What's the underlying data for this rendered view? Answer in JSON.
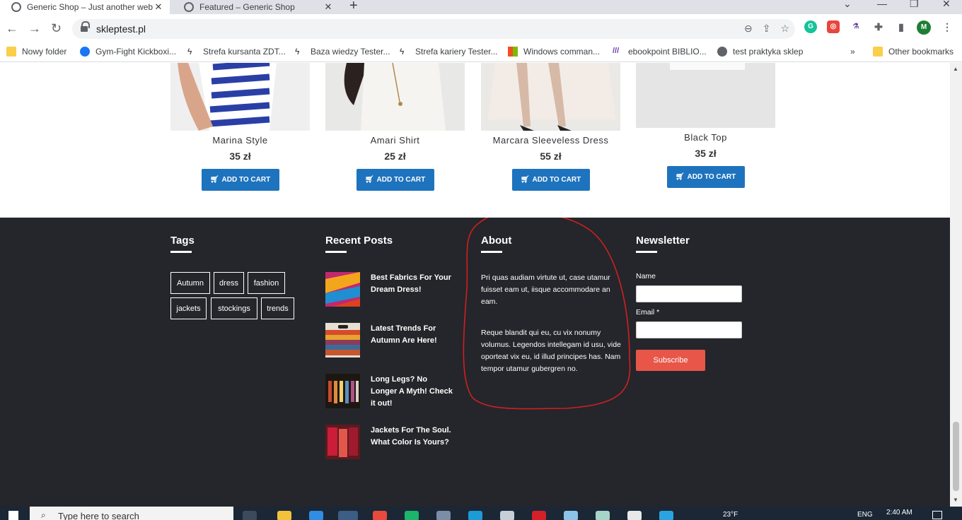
{
  "browser": {
    "tabs": [
      {
        "title": "Generic Shop – Just another web",
        "active": true
      },
      {
        "title": "Featured – Generic Shop",
        "active": false
      }
    ],
    "url": "skleptest.pl",
    "extension_avatar": "M",
    "bookmarks": [
      {
        "label": "Nowy folder",
        "icon": "folder-icon"
      },
      {
        "label": "Gym-Fight Kickboxi...",
        "icon": "facebook-icon"
      },
      {
        "label": "Strefa kursanta ZDT...",
        "icon": "zdt-icon"
      },
      {
        "label": "Baza wiedzy Tester...",
        "icon": "zdt-icon"
      },
      {
        "label": "Strefa kariery Tester...",
        "icon": "zdt-icon"
      },
      {
        "label": "Windows comman...",
        "icon": "windows-icon"
      },
      {
        "label": "ebookpoint BIBLIO...",
        "icon": "ebookpoint-icon"
      },
      {
        "label": "test praktyka sklep",
        "icon": "globe-icon"
      }
    ],
    "bookmarks_overflow": "»",
    "other_bookmarks": "Other bookmarks"
  },
  "products": [
    {
      "name": "Marina Style",
      "price": "35 zł",
      "button": "ADD TO CART"
    },
    {
      "name": "Amari Shirt",
      "price": "25 zł",
      "button": "ADD TO CART"
    },
    {
      "name": "Marcara Sleeveless Dress",
      "price": "55 zł",
      "button": "ADD TO CART"
    },
    {
      "name": "Black Top",
      "price": "35 zł",
      "button": "ADD TO CART"
    }
  ],
  "footer": {
    "tags_heading": "Tags",
    "tags": [
      "Autumn",
      "dress",
      "fashion",
      "jackets",
      "stockings",
      "trends"
    ],
    "recent_heading": "Recent Posts",
    "posts": [
      {
        "title": "Best Fabrics For Your Dream Dress!"
      },
      {
        "title": "Latest Trends For Autumn Are Here!"
      },
      {
        "title": "Long Legs? No Longer A Myth! Check it out!"
      },
      {
        "title": "Jackets For The Soul. What Color Is Yours?"
      }
    ],
    "about_heading": "About",
    "about_p1": "Pri quas audiam virtute ut, case utamur fuisset eam ut, iisque accommodare an eam.",
    "about_p2": "Reque blandit qui eu, cu vix nonumy volumus. Legendos intellegam id usu, vide oporteat vix eu, id illud principes has. Nam tempor utamur gubergren no.",
    "newsletter_heading": "Newsletter",
    "name_label": "Name",
    "email_label": "Email *",
    "subscribe_label": "Subscribe"
  },
  "taskbar": {
    "search_placeholder": "Type here to search",
    "weather": "23°F",
    "lang": "ENG",
    "time": "2:40 AM"
  },
  "colors": {
    "cart_button": "#1e73be",
    "footer_bg": "#24262b",
    "subscribe": "#e8564a",
    "annotation": "#d11f1f"
  }
}
